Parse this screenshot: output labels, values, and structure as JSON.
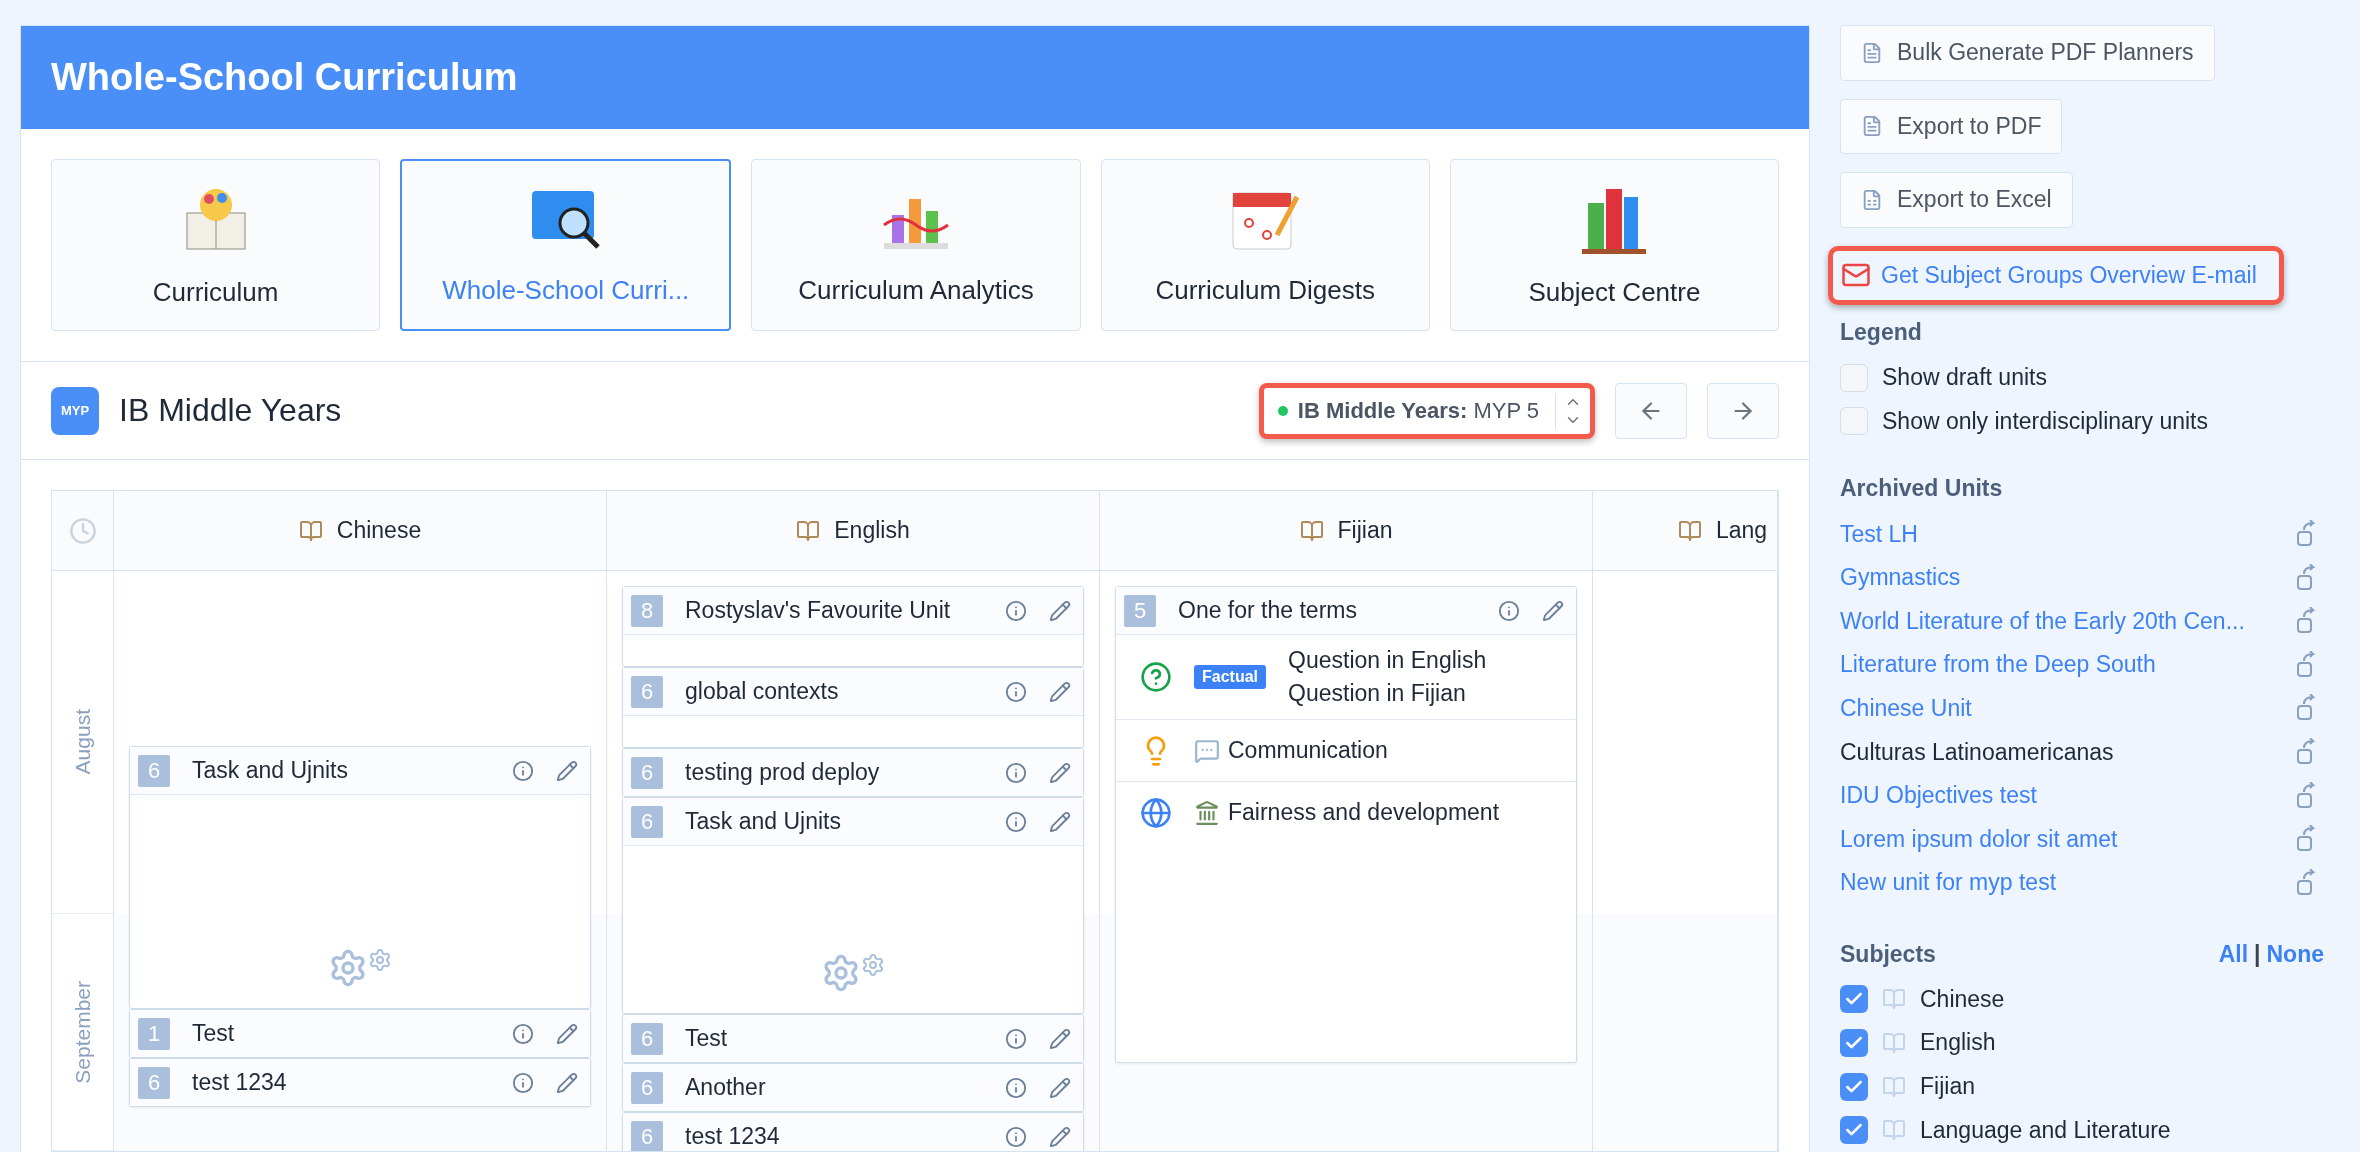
{
  "header": {
    "title": "Whole-School Curriculum"
  },
  "tiles": [
    {
      "label": "Curriculum",
      "selected": false
    },
    {
      "label": "Whole-School Curri...",
      "selected": true
    },
    {
      "label": "Curriculum Analytics",
      "selected": false
    },
    {
      "label": "Curriculum Digests",
      "selected": false
    },
    {
      "label": "Subject Centre",
      "selected": false
    }
  ],
  "programme": {
    "logo_text": "MYP",
    "title": "IB Middle Years",
    "selector": {
      "label": "IB Middle Years:",
      "value": "MYP 5",
      "highlighted": true
    }
  },
  "months": [
    "August",
    "September"
  ],
  "columns": [
    {
      "name": "Chinese",
      "units": [
        {
          "number": "6",
          "title": "Task and Ujnits",
          "kind": "open"
        },
        {
          "number": "1",
          "title": "Test",
          "kind": "header"
        },
        {
          "number": "6",
          "title": "test 1234",
          "kind": "header"
        }
      ]
    },
    {
      "name": "English",
      "units": [
        {
          "number": "8",
          "title": "Rostyslav's Favourite Unit",
          "kind": "clipped"
        },
        {
          "number": "6",
          "title": "global contexts",
          "kind": "clipped"
        },
        {
          "number": "6",
          "title": "testing prod deploy",
          "kind": "header"
        },
        {
          "number": "6",
          "title": "Task and Ujnits",
          "kind": "open"
        },
        {
          "number": "6",
          "title": "Test",
          "kind": "header"
        },
        {
          "number": "6",
          "title": "Another",
          "kind": "header"
        },
        {
          "number": "6",
          "title": "test 1234",
          "kind": "header"
        }
      ]
    },
    {
      "name": "Fijian",
      "units": [
        {
          "number": "5",
          "title": "One for the terms",
          "kind": "detail",
          "rows": [
            {
              "kind": "question",
              "tag": "Factual",
              "lines": [
                "Question in English",
                "Question in Fijian"
              ]
            },
            {
              "kind": "concept",
              "text": "Communication"
            },
            {
              "kind": "context",
              "text": "Fairness and development"
            }
          ]
        }
      ]
    },
    {
      "name": "Lang"
    }
  ],
  "sidebar": {
    "buttons": [
      {
        "label": "Bulk Generate PDF Planners",
        "kind": "pdf"
      },
      {
        "label": "Export to PDF",
        "kind": "pdf"
      },
      {
        "label": "Export to Excel",
        "kind": "excel"
      }
    ],
    "email_link": {
      "label": "Get Subject Groups Overview E-mail",
      "highlighted": true
    },
    "legend": {
      "title": "Legend",
      "options": [
        {
          "label": "Show draft units",
          "checked": false
        },
        {
          "label": "Show only interdisciplinary units",
          "checked": false
        }
      ]
    },
    "archived": {
      "title": "Archived Units",
      "items": [
        {
          "label": "Test LH",
          "linked": true
        },
        {
          "label": "Gymnastics",
          "linked": true
        },
        {
          "label": "World Literature of the Early 20th Cen...",
          "linked": true
        },
        {
          "label": "Literature from the Deep South",
          "linked": true
        },
        {
          "label": "Chinese Unit",
          "linked": true
        },
        {
          "label": "Culturas Latinoamericanas",
          "linked": false
        },
        {
          "label": "IDU Objectives test",
          "linked": true
        },
        {
          "label": "Lorem ipsum dolor sit amet",
          "linked": true
        },
        {
          "label": "New unit for myp test",
          "linked": true
        }
      ]
    },
    "subjects": {
      "title": "Subjects",
      "all": "All",
      "separator": "|",
      "none": "None",
      "items": [
        {
          "label": "Chinese",
          "checked": true
        },
        {
          "label": "English",
          "checked": true
        },
        {
          "label": "Fijian",
          "checked": true
        },
        {
          "label": "Language and Literature",
          "checked": true
        }
      ]
    }
  }
}
